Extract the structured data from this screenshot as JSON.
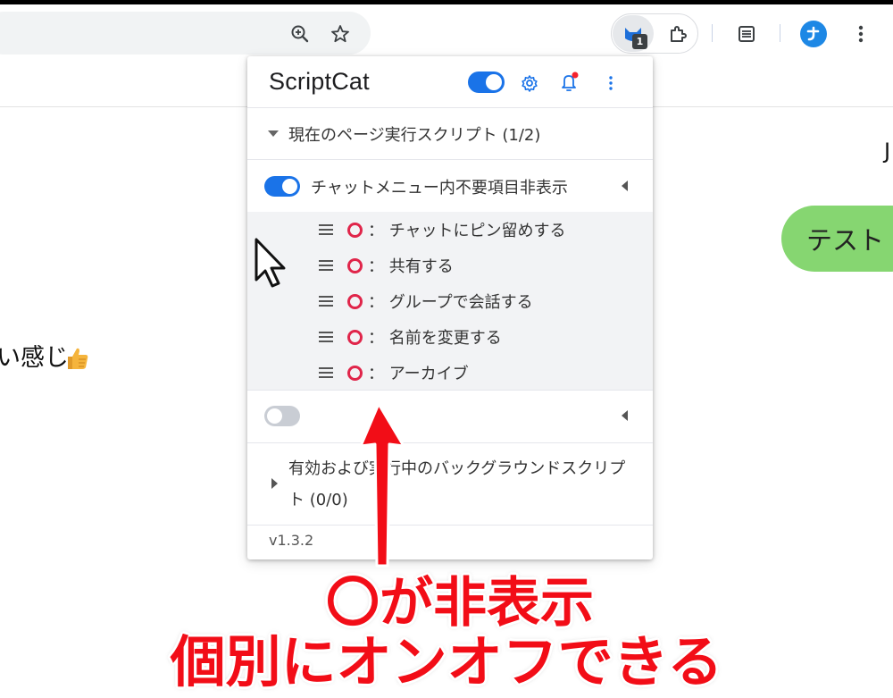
{
  "browser": {
    "extension_badge": "1"
  },
  "page": {
    "background_text": "い感じ",
    "bubble_text": "テスト",
    "edge_char": "J"
  },
  "popup": {
    "title": "ScriptCat",
    "current_page_section": "現在のページ実行スクリプト (1/2)",
    "scripts": [
      {
        "name": "チャットメニュー内不要項目非表示",
        "enabled": true,
        "menu_items": [
          {
            "status": "⭕",
            "label": "： チャットにピン留めする"
          },
          {
            "status": "⭕",
            "label": "： 共有する"
          },
          {
            "status": "⭕",
            "label": "： グループで会話する"
          },
          {
            "status": "⭕",
            "label": "： 名前を変更する"
          },
          {
            "status": "⭕",
            "label": "： アーカイブ"
          }
        ]
      },
      {
        "name": "",
        "enabled": false
      }
    ],
    "background_section": "有効および実行中のバックグラウンドスクリプト (0/0)",
    "version": "v1.3.2"
  },
  "caption": {
    "line1": "〇が非表示",
    "line2": "個別にオンオフできる"
  },
  "colors": {
    "accent": "#1a73e8",
    "ring": "#e0254a",
    "caption": "#f20d17",
    "bubble": "#86d671"
  }
}
